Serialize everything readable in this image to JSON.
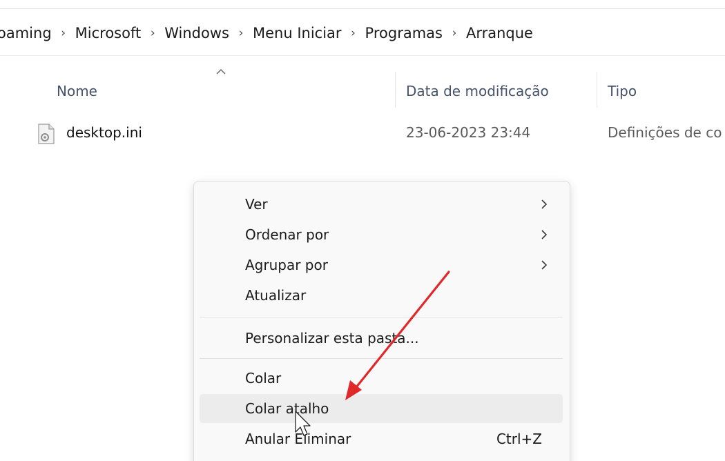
{
  "breadcrumb": {
    "items": [
      "oaming",
      "Microsoft",
      "Windows",
      "Menu Iniciar",
      "Programas",
      "Arranque"
    ],
    "separator": "›"
  },
  "columns": {
    "name": "Nome",
    "date_modified": "Data de modificação",
    "type": "Tipo",
    "sort": "ascending"
  },
  "files": [
    {
      "name": "desktop.ini",
      "date_modified": "23-06-2023 23:44",
      "type": "Definições de co",
      "icon": "settings-file-icon"
    }
  ],
  "context_menu": {
    "items": [
      {
        "label": "Ver",
        "submenu": true
      },
      {
        "label": "Ordenar por",
        "submenu": true
      },
      {
        "label": "Agrupar por",
        "submenu": true
      },
      {
        "label": "Atualizar",
        "submenu": false
      },
      {
        "label": "Personalizar esta pasta...",
        "submenu": false
      },
      {
        "label": "Colar",
        "submenu": false
      },
      {
        "label": "Colar atalho",
        "submenu": false,
        "highlighted": true
      },
      {
        "label": "Anular Eliminar",
        "shortcut": "Ctrl+Z"
      }
    ]
  },
  "annotation": {
    "arrow_color": "#e0282a",
    "points_to": "Colar atalho"
  },
  "colors": {
    "menu_background": "#f9f9f9",
    "hover_background": "#ececec",
    "header_text": "#45526a"
  }
}
